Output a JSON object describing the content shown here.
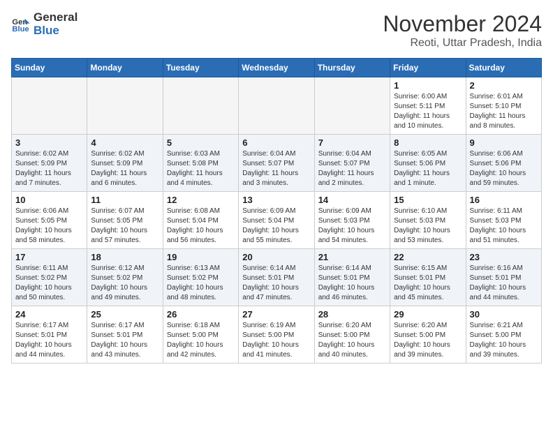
{
  "header": {
    "logo_general": "General",
    "logo_blue": "Blue",
    "month_title": "November 2024",
    "location": "Reoti, Uttar Pradesh, India"
  },
  "days_of_week": [
    "Sunday",
    "Monday",
    "Tuesday",
    "Wednesday",
    "Thursday",
    "Friday",
    "Saturday"
  ],
  "weeks": [
    [
      {
        "day": "",
        "info": ""
      },
      {
        "day": "",
        "info": ""
      },
      {
        "day": "",
        "info": ""
      },
      {
        "day": "",
        "info": ""
      },
      {
        "day": "",
        "info": ""
      },
      {
        "day": "1",
        "info": "Sunrise: 6:00 AM\nSunset: 5:11 PM\nDaylight: 11 hours\nand 10 minutes."
      },
      {
        "day": "2",
        "info": "Sunrise: 6:01 AM\nSunset: 5:10 PM\nDaylight: 11 hours\nand 8 minutes."
      }
    ],
    [
      {
        "day": "3",
        "info": "Sunrise: 6:02 AM\nSunset: 5:09 PM\nDaylight: 11 hours\nand 7 minutes."
      },
      {
        "day": "4",
        "info": "Sunrise: 6:02 AM\nSunset: 5:09 PM\nDaylight: 11 hours\nand 6 minutes."
      },
      {
        "day": "5",
        "info": "Sunrise: 6:03 AM\nSunset: 5:08 PM\nDaylight: 11 hours\nand 4 minutes."
      },
      {
        "day": "6",
        "info": "Sunrise: 6:04 AM\nSunset: 5:07 PM\nDaylight: 11 hours\nand 3 minutes."
      },
      {
        "day": "7",
        "info": "Sunrise: 6:04 AM\nSunset: 5:07 PM\nDaylight: 11 hours\nand 2 minutes."
      },
      {
        "day": "8",
        "info": "Sunrise: 6:05 AM\nSunset: 5:06 PM\nDaylight: 11 hours\nand 1 minute."
      },
      {
        "day": "9",
        "info": "Sunrise: 6:06 AM\nSunset: 5:06 PM\nDaylight: 10 hours\nand 59 minutes."
      }
    ],
    [
      {
        "day": "10",
        "info": "Sunrise: 6:06 AM\nSunset: 5:05 PM\nDaylight: 10 hours\nand 58 minutes."
      },
      {
        "day": "11",
        "info": "Sunrise: 6:07 AM\nSunset: 5:05 PM\nDaylight: 10 hours\nand 57 minutes."
      },
      {
        "day": "12",
        "info": "Sunrise: 6:08 AM\nSunset: 5:04 PM\nDaylight: 10 hours\nand 56 minutes."
      },
      {
        "day": "13",
        "info": "Sunrise: 6:09 AM\nSunset: 5:04 PM\nDaylight: 10 hours\nand 55 minutes."
      },
      {
        "day": "14",
        "info": "Sunrise: 6:09 AM\nSunset: 5:03 PM\nDaylight: 10 hours\nand 54 minutes."
      },
      {
        "day": "15",
        "info": "Sunrise: 6:10 AM\nSunset: 5:03 PM\nDaylight: 10 hours\nand 53 minutes."
      },
      {
        "day": "16",
        "info": "Sunrise: 6:11 AM\nSunset: 5:03 PM\nDaylight: 10 hours\nand 51 minutes."
      }
    ],
    [
      {
        "day": "17",
        "info": "Sunrise: 6:11 AM\nSunset: 5:02 PM\nDaylight: 10 hours\nand 50 minutes."
      },
      {
        "day": "18",
        "info": "Sunrise: 6:12 AM\nSunset: 5:02 PM\nDaylight: 10 hours\nand 49 minutes."
      },
      {
        "day": "19",
        "info": "Sunrise: 6:13 AM\nSunset: 5:02 PM\nDaylight: 10 hours\nand 48 minutes."
      },
      {
        "day": "20",
        "info": "Sunrise: 6:14 AM\nSunset: 5:01 PM\nDaylight: 10 hours\nand 47 minutes."
      },
      {
        "day": "21",
        "info": "Sunrise: 6:14 AM\nSunset: 5:01 PM\nDaylight: 10 hours\nand 46 minutes."
      },
      {
        "day": "22",
        "info": "Sunrise: 6:15 AM\nSunset: 5:01 PM\nDaylight: 10 hours\nand 45 minutes."
      },
      {
        "day": "23",
        "info": "Sunrise: 6:16 AM\nSunset: 5:01 PM\nDaylight: 10 hours\nand 44 minutes."
      }
    ],
    [
      {
        "day": "24",
        "info": "Sunrise: 6:17 AM\nSunset: 5:01 PM\nDaylight: 10 hours\nand 44 minutes."
      },
      {
        "day": "25",
        "info": "Sunrise: 6:17 AM\nSunset: 5:01 PM\nDaylight: 10 hours\nand 43 minutes."
      },
      {
        "day": "26",
        "info": "Sunrise: 6:18 AM\nSunset: 5:00 PM\nDaylight: 10 hours\nand 42 minutes."
      },
      {
        "day": "27",
        "info": "Sunrise: 6:19 AM\nSunset: 5:00 PM\nDaylight: 10 hours\nand 41 minutes."
      },
      {
        "day": "28",
        "info": "Sunrise: 6:20 AM\nSunset: 5:00 PM\nDaylight: 10 hours\nand 40 minutes."
      },
      {
        "day": "29",
        "info": "Sunrise: 6:20 AM\nSunset: 5:00 PM\nDaylight: 10 hours\nand 39 minutes."
      },
      {
        "day": "30",
        "info": "Sunrise: 6:21 AM\nSunset: 5:00 PM\nDaylight: 10 hours\nand 39 minutes."
      }
    ]
  ]
}
